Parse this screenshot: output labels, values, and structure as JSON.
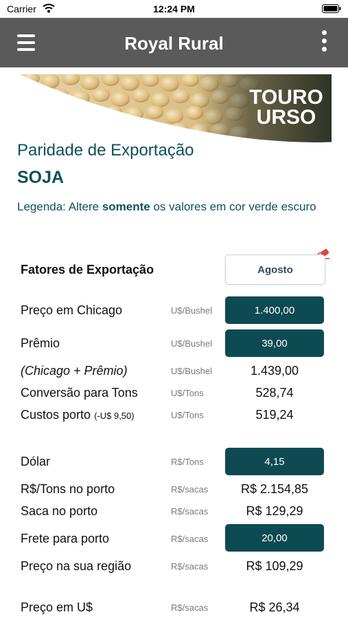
{
  "status_bar": {
    "carrier": "Carrier",
    "time": "12:24 PM"
  },
  "nav": {
    "title": "Royal Rural"
  },
  "banner": {
    "logo_line1": "TOURO",
    "logo_line2": "URSO"
  },
  "header": {
    "partial_title": "Paridade de Exportação",
    "crop": "SOJA",
    "legend_prefix": "Legenda: Altere ",
    "legend_bold": "somente",
    "legend_suffix": " os valores em cor verde escuro"
  },
  "factors": {
    "title": "Fatores de Exportação",
    "month": "Agosto"
  },
  "rows": {
    "chicago": {
      "label": "Preço em Chicago",
      "unit": "U$/Bushel",
      "value": "1.400,00"
    },
    "premio": {
      "label": "Prêmio",
      "unit": "U$/Bushel",
      "value": "39,00"
    },
    "soma": {
      "label": "(Chicago + Prêmio)",
      "unit": "U$/Bushel",
      "value": "1.439,00"
    },
    "conversao": {
      "label": "Conversão para Tons",
      "unit": "U$/Tons",
      "value": "528,74"
    },
    "custos": {
      "label": "Custos porto",
      "label_note": "(-U$ 9,50)",
      "unit": "U$/Tons",
      "value": "519,24"
    },
    "dolar": {
      "label": "Dólar",
      "unit": "R$/Tons",
      "value": "4,15"
    },
    "tons_porto": {
      "label": "R$/Tons no porto",
      "unit": "R$/sacas",
      "value": "R$ 2.154,85"
    },
    "saca_porto": {
      "label": "Saca no porto",
      "unit": "R$/sacas",
      "value": "R$ 129,29"
    },
    "frete": {
      "label": "Frete para porto",
      "unit": "R$/sacas",
      "value": "20,00"
    },
    "regiao": {
      "label": "Preço na sua região",
      "unit": "R$/sacas",
      "value": "R$ 109,29"
    },
    "usd": {
      "label": "Preço em U$",
      "unit": "R$/sacas",
      "value": "R$ 26,34"
    }
  },
  "colors": {
    "nav_bg": "#5a5a5a",
    "accent_dark_teal": "#0e4a52",
    "title_teal": "#0e5159",
    "eraser_red": "#e0443c"
  },
  "icons": {
    "menu": "hamburger-menu-icon",
    "more": "vertical-dots-icon",
    "eraser": "eraser-icon",
    "wifi": "wifi-icon",
    "battery": "battery-icon"
  }
}
